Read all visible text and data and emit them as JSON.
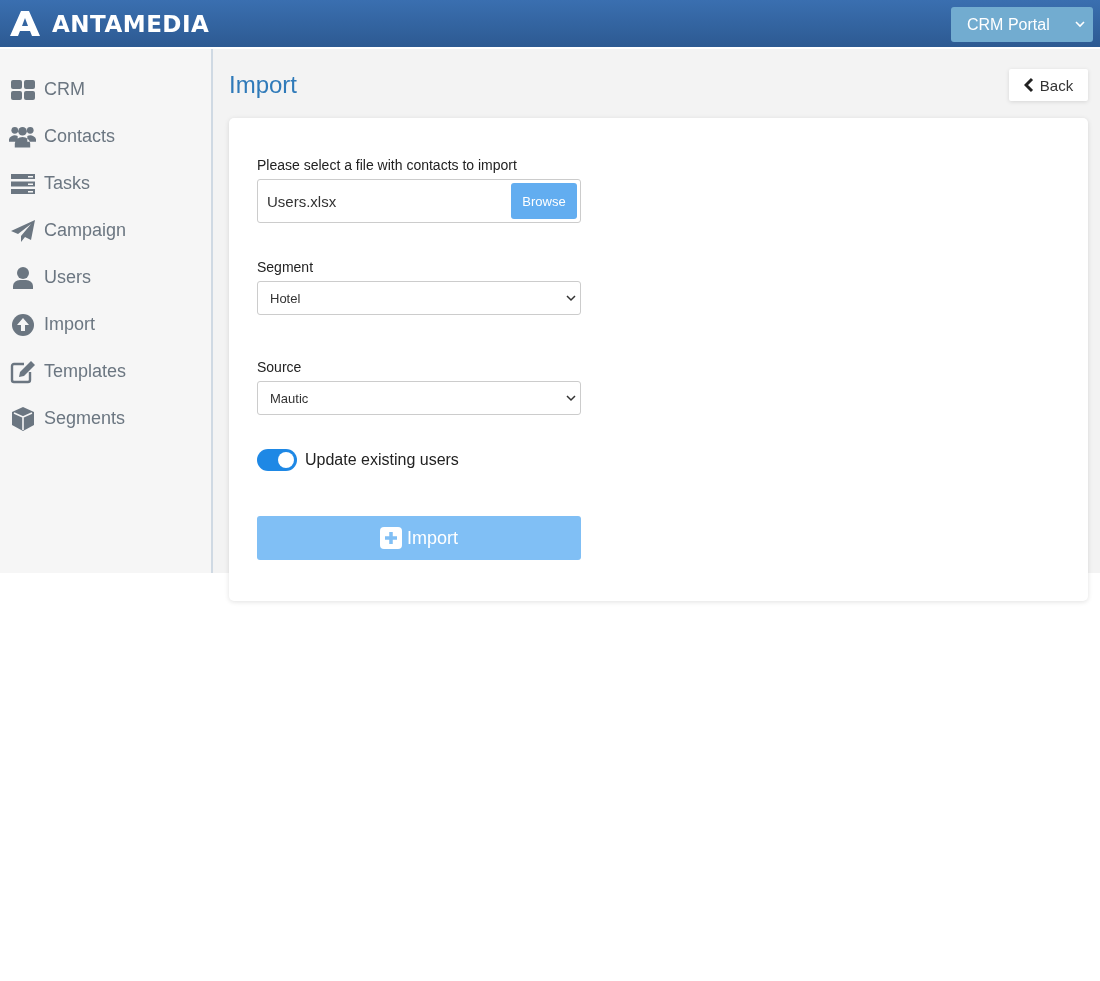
{
  "header": {
    "logo": "ANTAMEDIA",
    "portal_select": "CRM Portal"
  },
  "sidebar": {
    "items": [
      {
        "label": "CRM"
      },
      {
        "label": "Contacts"
      },
      {
        "label": "Tasks"
      },
      {
        "label": "Campaign"
      },
      {
        "label": "Users"
      },
      {
        "label": "Import"
      },
      {
        "label": "Templates"
      },
      {
        "label": "Segments"
      }
    ]
  },
  "page": {
    "title": "Import",
    "back_button": "Back"
  },
  "form": {
    "file_label": "Please select a file with contacts to import",
    "file_value": "Users.xlsx",
    "browse_button": "Browse",
    "segment_label": "Segment",
    "segment_value": "Hotel",
    "source_label": "Source",
    "source_value": "Mautic",
    "toggle": {
      "label": "Update existing users",
      "on": true
    },
    "submit": {
      "label": "Import",
      "disabled": true
    }
  }
}
